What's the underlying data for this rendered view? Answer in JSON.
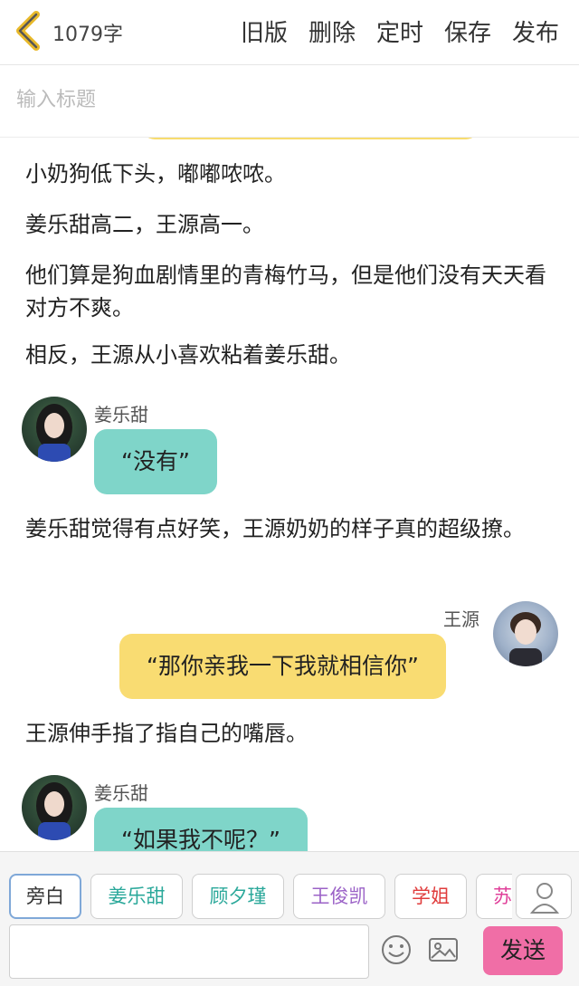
{
  "header": {
    "back_icon": "chevron-left-icon",
    "word_count": "1079字",
    "actions": [
      "旧版",
      "删除",
      "定时",
      "保存",
      "发布"
    ],
    "accent": "#e8b92b"
  },
  "title_input": {
    "placeholder": "输入标题",
    "value": ""
  },
  "story": {
    "paragraphs": [
      "小奶狗低下头，嘟嘟哝哝。",
      "姜乐甜高二，王源高一。",
      "他们算是狗血剧情里的青梅竹马，但是他们没有天天看对方不爽。",
      "相反，王源从小喜欢粘着姜乐甜。",
      "姜乐甜觉得有点好笑，王源奶奶的样子真的超级撩。",
      "王源伸手指了指自己的嘴唇。"
    ],
    "messages": [
      {
        "speaker": "姜乐甜",
        "text": "“没有”",
        "side": "left",
        "color": "#7fd5c9"
      },
      {
        "speaker": "王源",
        "text": "“那你亲我一下我就相信你”",
        "side": "right",
        "color": "#f9dc72"
      },
      {
        "speaker": "姜乐甜",
        "text": "“如果我不呢？”",
        "side": "left",
        "color": "#7fd5c9"
      }
    ]
  },
  "toolbar": {
    "characters": [
      {
        "label": "旁白",
        "color": "#333333",
        "selected": true
      },
      {
        "label": "姜乐甜",
        "color": "#2aa89a",
        "selected": false
      },
      {
        "label": "顾夕瑾",
        "color": "#2aa89a",
        "selected": false
      },
      {
        "label": "王俊凯",
        "color": "#9b62c7",
        "selected": false
      },
      {
        "label": "学姐",
        "color": "#e03c3c",
        "selected": false
      },
      {
        "label": "苏",
        "color": "#e0409a",
        "selected": false
      }
    ],
    "person_icon": "person-icon",
    "message_placeholder": "",
    "emoji_icon": "emoji-icon",
    "image_icon": "image-icon",
    "send_label": "发送",
    "send_color": "#f06ea6"
  }
}
